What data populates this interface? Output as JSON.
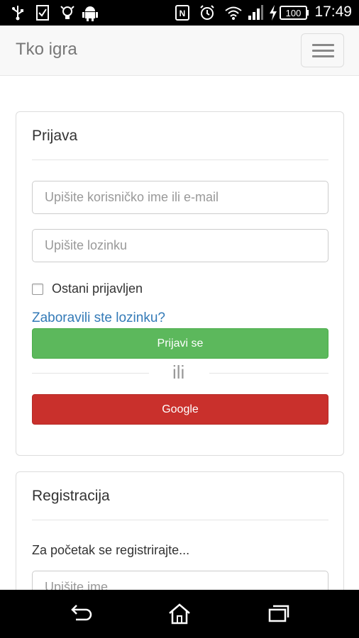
{
  "status_bar": {
    "time": "17:49",
    "battery": "100",
    "icons": [
      "usb-icon",
      "checkbox-notification-icon",
      "bulb-icon",
      "android-icon",
      "nfc-icon",
      "alarm-icon",
      "wifi-icon",
      "signal-icon",
      "charging-icon",
      "battery-icon"
    ]
  },
  "navbar": {
    "brand": "Tko igra",
    "menu_icon": "hamburger-menu-icon"
  },
  "login": {
    "title": "Prijava",
    "username_placeholder": "Upišite korisničko ime ili e-mail",
    "password_placeholder": "Upišite lozinku",
    "remember_label": "Ostani prijavljen",
    "forgot_link": "Zaboravili ste lozinku?",
    "submit_label": "Prijavi se",
    "or_label": "ili",
    "google_label": "Google"
  },
  "register": {
    "title": "Registracija",
    "intro": "Za početak se registrirajte...",
    "name_placeholder": "Upišite ime"
  },
  "system_nav": {
    "back_icon": "back-icon",
    "home_icon": "home-icon",
    "recents_icon": "recents-icon"
  },
  "colors": {
    "success": "#5cb85c",
    "danger": "#c9302c",
    "link": "#337ab7"
  }
}
